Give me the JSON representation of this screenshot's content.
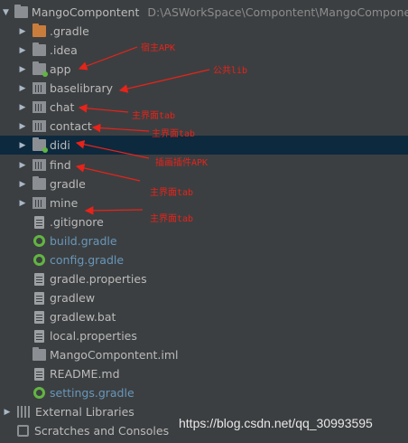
{
  "root": {
    "name": "MangoCompontent",
    "path": "D:\\ASWorkSpace\\Compontent\\MangoComponent"
  },
  "items": [
    {
      "label": ".gradle",
      "icon": "orange-folder-icon"
    },
    {
      "label": ".idea",
      "icon": "folder-icon"
    },
    {
      "label": "app",
      "icon": "app-module-icon"
    },
    {
      "label": "baselibrary",
      "icon": "library-module-icon"
    },
    {
      "label": "chat",
      "icon": "library-module-icon"
    },
    {
      "label": "contact",
      "icon": "library-module-icon"
    },
    {
      "label": "didi",
      "icon": "app-module-icon"
    },
    {
      "label": "find",
      "icon": "library-module-icon"
    },
    {
      "label": "gradle",
      "icon": "folder-icon"
    },
    {
      "label": "mine",
      "icon": "library-module-icon"
    },
    {
      "label": ".gitignore",
      "icon": "file-icon"
    },
    {
      "label": "build.gradle",
      "icon": "gradle-file-icon"
    },
    {
      "label": "config.gradle",
      "icon": "gradle-file-icon"
    },
    {
      "label": "gradle.properties",
      "icon": "file-icon"
    },
    {
      "label": "gradlew",
      "icon": "file-icon"
    },
    {
      "label": "gradlew.bat",
      "icon": "file-icon"
    },
    {
      "label": "local.properties",
      "icon": "file-icon"
    },
    {
      "label": "MangoCompontent.iml",
      "icon": "file-icon"
    },
    {
      "label": "README.md",
      "icon": "file-icon"
    },
    {
      "label": "settings.gradle",
      "icon": "gradle-file-icon"
    }
  ],
  "bottom": {
    "external_libraries": "External Libraries",
    "scratches": "Scratches and Consoles"
  },
  "annotations": {
    "app": "宿主APK",
    "baselibrary": "公共lib",
    "chat": "主界面tab",
    "contact": "主界面tab",
    "didi": "插画插件APK",
    "find": "主界面tab",
    "mine": "主界面tab"
  },
  "watermark": "https://blog.csdn.net/qq_30993595",
  "colors": {
    "background": "#3c3f41",
    "selection": "#0d293e",
    "annotation": "#e8231a",
    "gradle_text": "#6897bb"
  }
}
